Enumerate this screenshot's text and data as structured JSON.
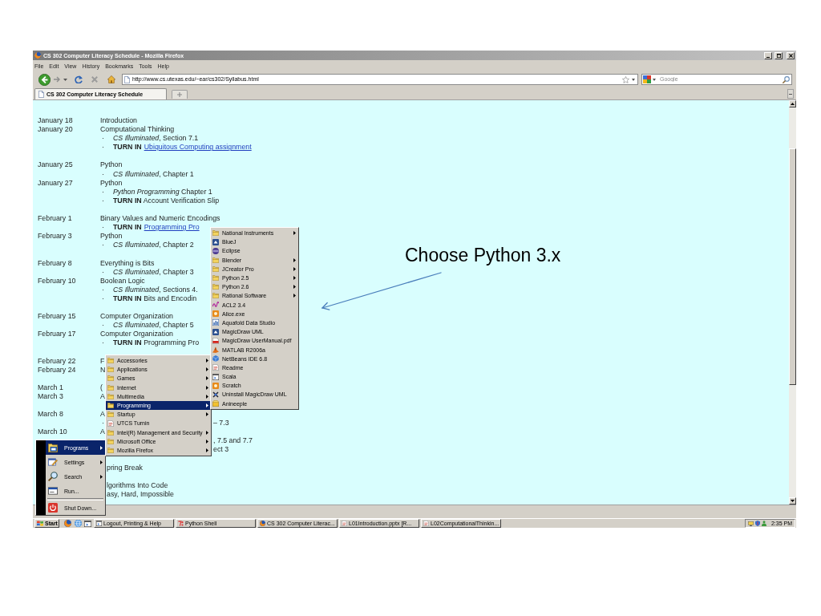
{
  "window": {
    "title": "CS 302 Computer Literacy Schedule - Mozilla Firefox"
  },
  "menu_bar": [
    "File",
    "Edit",
    "View",
    "History",
    "Bookmarks",
    "Tools",
    "Help"
  ],
  "toolbar": {
    "url": "http://www.cs.utexas.edu/~ear/cs302/Syllabus.html",
    "search": {
      "placeholder": "Google"
    }
  },
  "tabs": [
    {
      "label": "CS 302 Computer Literacy Schedule",
      "selected": true
    }
  ],
  "schedule": [
    {
      "lines": [
        {
          "kind": "topic",
          "date": "January 18",
          "text": "Introduction"
        },
        {
          "kind": "topic",
          "date": "January 20",
          "text": "Computational Thinking"
        },
        {
          "kind": "item",
          "marker": "·",
          "text": "*CS Illuminated*, Section 7.1"
        },
        {
          "kind": "item",
          "marker": "·",
          "text": "**TURN IN**",
          "link": "Ubiquitous Computing assignment"
        }
      ]
    },
    {
      "lines": [
        {
          "kind": "topic",
          "date": "January 25",
          "text": "Python"
        },
        {
          "kind": "item",
          "marker": "·",
          "text": "*CS Illuminated*, Chapter 1"
        },
        {
          "kind": "topic",
          "date": "January 27",
          "text": "Python"
        },
        {
          "kind": "item",
          "marker": "·",
          "text": "*Python Programming* Chapter 1"
        },
        {
          "kind": "item",
          "marker": "·",
          "text": "**TURN IN** Account Verification Slip"
        }
      ]
    },
    {
      "lines": [
        {
          "kind": "topic",
          "date": "February 1",
          "text": "Binary Values and Numeric Encodings"
        },
        {
          "kind": "item",
          "marker": "·",
          "text": "**TURN IN**",
          "link": "Programming Pro"
        },
        {
          "kind": "topic",
          "date": "February 3",
          "text": "Python"
        },
        {
          "kind": "item",
          "marker": "·",
          "text": "*CS Illuminated*, Chapter 2"
        }
      ]
    },
    {
      "lines": [
        {
          "kind": "topic",
          "date": "February 8",
          "text": "Everything is Bits"
        },
        {
          "kind": "item",
          "marker": "·",
          "text": "*CS Illuminated*, Chapter 3"
        },
        {
          "kind": "topic",
          "date": "February 10",
          "text": "Boolean Logic"
        },
        {
          "kind": "item",
          "marker": "·",
          "text": "*CS Illuminated*, Sections 4."
        },
        {
          "kind": "item",
          "marker": "·",
          "text": "**TURN IN** Bits and Encodin"
        }
      ]
    },
    {
      "lines": [
        {
          "kind": "topic",
          "date": "February 15",
          "text": "Computer Organization"
        },
        {
          "kind": "item",
          "marker": "·",
          "text": "*CS Illuminated*, Chapter 5"
        },
        {
          "kind": "topic",
          "date": "February 17",
          "text": "Computer Organization"
        },
        {
          "kind": "item",
          "marker": "·",
          "text": "**TURN IN** Programming Pro"
        }
      ]
    },
    {
      "lines": [
        {
          "kind": "topic",
          "date": "February 22",
          "text": "F"
        },
        {
          "kind": "topic",
          "date": "February 24",
          "text": "N"
        }
      ]
    },
    {
      "lines": [
        {
          "kind": "topic",
          "date": "March 1",
          "text": "("
        },
        {
          "kind": "topic",
          "date": "March 3",
          "text": "A"
        }
      ]
    },
    {
      "lines": [
        {
          "kind": "topic",
          "date": "March 8",
          "text": "A"
        },
        {
          "kind": "menuclip",
          "marker": "·",
          "text": "– 7.3"
        },
        {
          "kind": "topic",
          "date": "March 10",
          "text": "A"
        },
        {
          "kind": "menuclip",
          "text": ", 7.5 and 7.7"
        },
        {
          "kind": "menuclip",
          "text": "ect 3"
        }
      ]
    },
    {
      "lines": [
        {
          "kind": "startclip",
          "text": "pring Break"
        }
      ]
    },
    {
      "lines": [
        {
          "kind": "startclip",
          "text": "lgorithms Into Code"
        },
        {
          "kind": "startclip",
          "text": "asy, Hard, Impossible"
        }
      ]
    }
  ],
  "start_menu": {
    "items": [
      {
        "label": "Programs",
        "selected": true,
        "submenu": true
      },
      {
        "label": "Settings",
        "selected": false,
        "submenu": true
      },
      {
        "label": "Search",
        "selected": false,
        "submenu": true
      },
      {
        "label": "Run...",
        "selected": false,
        "submenu": false
      },
      {
        "label": "Shut Down...",
        "selected": false,
        "submenu": false,
        "divider": true
      }
    ]
  },
  "programs_menu": {
    "items": [
      {
        "label": "Accessories",
        "selected": false,
        "submenu": true
      },
      {
        "label": "Applications",
        "selected": false,
        "submenu": true
      },
      {
        "label": "Games",
        "selected": false,
        "submenu": true
      },
      {
        "label": "Internet",
        "selected": false,
        "submenu": true
      },
      {
        "label": "Multimedia",
        "selected": false,
        "submenu": true
      },
      {
        "label": "Programming",
        "selected": true,
        "submenu": true
      },
      {
        "label": "Startup",
        "selected": false,
        "submenu": true
      },
      {
        "label": "UTCS Turnin",
        "selected": false,
        "submenu": false
      },
      {
        "label": "Intel(R) Management and Security",
        "selected": false,
        "submenu": true
      },
      {
        "label": "Microsoft Office",
        "selected": false,
        "submenu": true
      },
      {
        "label": "Mozilla Firefox",
        "selected": false,
        "submenu": true
      }
    ]
  },
  "programming_menu": {
    "items": [
      {
        "label": "National Instruments",
        "selected": false,
        "submenu": true
      },
      {
        "label": "BlueJ",
        "selected": false,
        "submenu": false
      },
      {
        "label": "Eclipse",
        "selected": false,
        "submenu": false
      },
      {
        "label": "Blender",
        "selected": false,
        "submenu": true
      },
      {
        "label": "JCreator Pro",
        "selected": false,
        "submenu": true
      },
      {
        "label": "Python 2.5",
        "selected": false,
        "submenu": true
      },
      {
        "label": "Python 2.6",
        "selected": false,
        "submenu": true
      },
      {
        "label": "Rational Software",
        "selected": false,
        "submenu": true
      },
      {
        "label": "ACL2 3.4",
        "selected": false,
        "submenu": false
      },
      {
        "label": "Alice.exe",
        "selected": false,
        "submenu": false
      },
      {
        "label": "Aquafold Data Studio",
        "selected": false,
        "submenu": false
      },
      {
        "label": "MagicDraw UML",
        "selected": false,
        "submenu": false
      },
      {
        "label": "MagicDraw UserManual.pdf",
        "selected": false,
        "submenu": false
      },
      {
        "label": "MATLAB R2006a",
        "selected": false,
        "submenu": false
      },
      {
        "label": "NetBeans IDE 6.8",
        "selected": false,
        "submenu": false
      },
      {
        "label": "Readme",
        "selected": false,
        "submenu": false
      },
      {
        "label": "Scala",
        "selected": false,
        "submenu": false
      },
      {
        "label": "Scratch",
        "selected": false,
        "submenu": false
      },
      {
        "label": "Uninstall MagicDraw UML",
        "selected": false,
        "submenu": false
      },
      {
        "label": "Anineeple",
        "selected": false,
        "submenu": false
      }
    ]
  },
  "taskbar": {
    "start": "Start",
    "tasks": [
      {
        "label": "Logout, Printing & Help"
      },
      {
        "label": "Python Shell"
      },
      {
        "label": "CS 302 Computer Literac..."
      },
      {
        "label": "L01Introduction.pptx [R..."
      },
      {
        "label": "L02ComputationalThinkin..."
      }
    ],
    "clock": "2:35 PM"
  },
  "annotation": {
    "text": "Choose Python 3.x"
  }
}
